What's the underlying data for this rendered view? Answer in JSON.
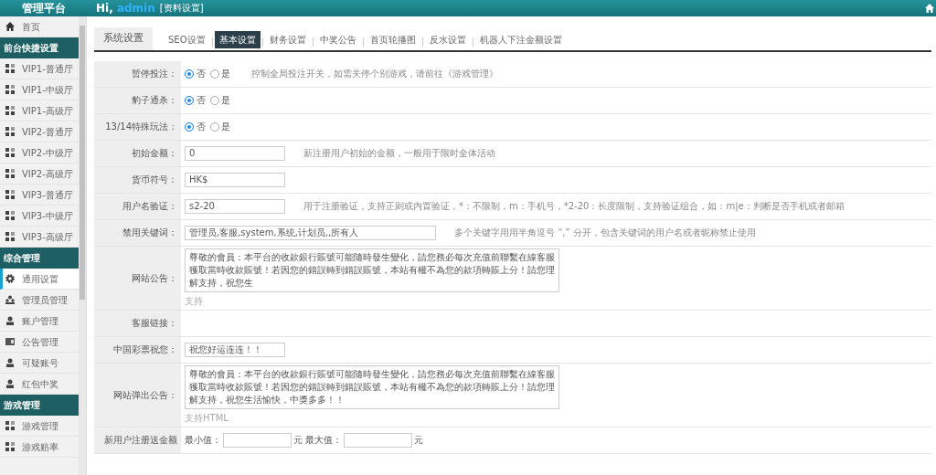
{
  "header": {
    "title": "管理平台",
    "greeting": "Hi,",
    "user": "admin",
    "profile_link": "[资料设置]"
  },
  "sidebar": {
    "items": [
      {
        "kind": "home",
        "label": "首页",
        "selected": false
      },
      {
        "kind": "section",
        "label": "前台快捷设置"
      },
      {
        "kind": "hall",
        "label": "VIP1-普通厅",
        "selected": false
      },
      {
        "kind": "hall",
        "label": "VIP1-中级厅",
        "selected": false
      },
      {
        "kind": "hall",
        "label": "VIP1-高级厅",
        "selected": false
      },
      {
        "kind": "hall",
        "label": "VIP2-普通厅",
        "selected": false
      },
      {
        "kind": "hall",
        "label": "VIP2-中级厅",
        "selected": false
      },
      {
        "kind": "hall",
        "label": "VIP2-高级厅",
        "selected": false
      },
      {
        "kind": "hall",
        "label": "VIP3-普通厅",
        "selected": false
      },
      {
        "kind": "hall",
        "label": "VIP3-中级厅",
        "selected": false
      },
      {
        "kind": "hall",
        "label": "VIP3-高级厅",
        "selected": false
      },
      {
        "kind": "section",
        "label": "综合管理"
      },
      {
        "kind": "gear",
        "label": "通用设置",
        "selected": true
      },
      {
        "kind": "group",
        "label": "管理员管理",
        "selected": false
      },
      {
        "kind": "user",
        "label": "账户管理",
        "selected": false
      },
      {
        "kind": "card",
        "label": "公告管理",
        "selected": false
      },
      {
        "kind": "user",
        "label": "可疑账号",
        "selected": false
      },
      {
        "kind": "user",
        "label": "红包中奖",
        "selected": false
      },
      {
        "kind": "section",
        "label": "游戏管理"
      },
      {
        "kind": "hall",
        "label": "游戏管理",
        "selected": false
      },
      {
        "kind": "hall",
        "label": "游戏赔率",
        "selected": false
      }
    ]
  },
  "tabs": [
    {
      "kind": "title",
      "label": "系统设置"
    },
    {
      "kind": "tab",
      "label": "SEO设置",
      "selected": false
    },
    {
      "kind": "tab",
      "label": "基本设置",
      "selected": true
    },
    {
      "kind": "tab",
      "label": "财务设置",
      "selected": false
    },
    {
      "kind": "tab",
      "label": "中奖公告",
      "selected": false
    },
    {
      "kind": "tab",
      "label": "首页轮播图",
      "selected": false
    },
    {
      "kind": "tab",
      "label": "反水设置",
      "selected": false
    },
    {
      "kind": "tab",
      "label": "机器人下注金额设置",
      "selected": false
    }
  ],
  "form": {
    "rows": [
      {
        "kind": "radio",
        "label": "暂停投注：",
        "options": [
          {
            "label": "否",
            "selected": true
          },
          {
            "label": "是",
            "selected": false
          }
        ],
        "help": "控制全局投注开关，如需关停个别游戏，请前往《游戏管理》"
      },
      {
        "kind": "radio",
        "label": "豹子通杀：",
        "options": [
          {
            "label": "否",
            "selected": true
          },
          {
            "label": "是",
            "selected": false
          }
        ]
      },
      {
        "kind": "radio",
        "label": "13/14特殊玩法：",
        "options": [
          {
            "label": "否",
            "selected": true
          },
          {
            "label": "是",
            "selected": false
          }
        ]
      },
      {
        "kind": "text",
        "label": "初始金额：",
        "value": "0",
        "help": "新注册用户初始的金额，一般用于限时全体活动"
      },
      {
        "kind": "text",
        "label": "货币符号：",
        "value": "HK$"
      },
      {
        "kind": "text",
        "label": "用户名验证：",
        "value": "s2-20",
        "help": "用于注册验证，支持正则或内置验证，*：不限制，m：手机号，*2-20：长度限制，支持验证组合，如：m|e：判断是否手机或者邮箱"
      },
      {
        "kind": "wide",
        "label": "禁用关键词：",
        "value": "管理员,客服,system,系统,计划员,,所有人",
        "help": "多个关键字用用半角逗号 “,” 分开，包含关键词的用户名或者昵称禁止使用"
      },
      {
        "kind": "textarea",
        "label": "网站公告：",
        "value": "尊敬的會員：本平台的收款銀行賬號可能隨時發生變化，請您務必每次充值前聯繫在線客服獲取當時收款賬號！若因您的錯誤轉到錯誤賬號，本站有權不為您的款項轉賬上分！請您理解支持，祝您生",
        "hint": "支持"
      },
      {
        "kind": "empty",
        "label": "客服链接："
      },
      {
        "kind": "text",
        "label": "中国彩票祝您：",
        "value": "祝您好运连连！！"
      },
      {
        "kind": "textarea",
        "label": "网站弹出公告：",
        "value": "尊敬的會員：本平台的收款銀行賬號可能隨時發生變化，請您務必每次充值前聯繫在線客服獲取當時收款賬號！若因您的錯誤轉到錯誤賬號，本站有權不為您的款項轉賬上分！請您理解支持，祝您生活愉快，中獎多多！！",
        "hint": "支持HTML"
      },
      {
        "kind": "range",
        "label": "新用户注册送金额",
        "min_label": "最小值：",
        "unit1": "元",
        "max_label": "最大值：",
        "unit2": "元"
      }
    ]
  }
}
